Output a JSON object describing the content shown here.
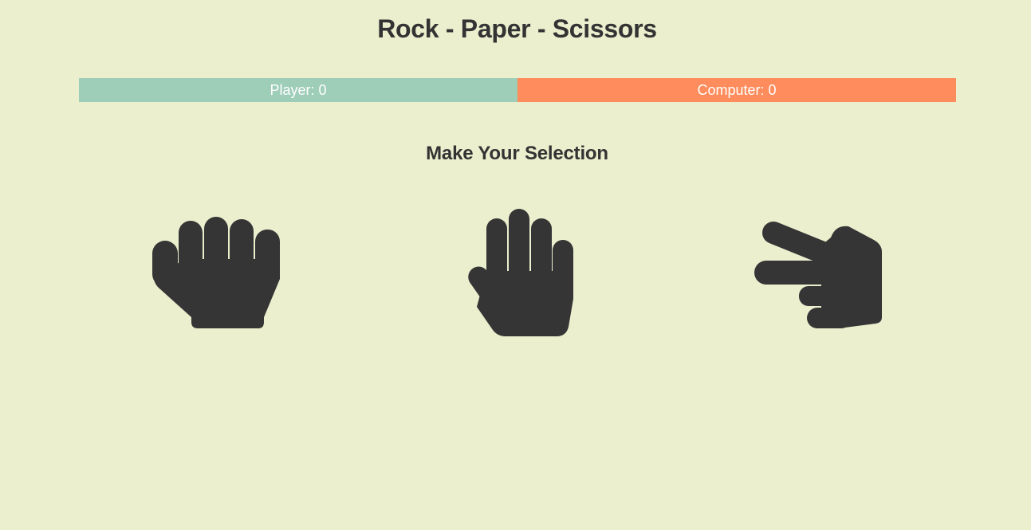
{
  "header": {
    "title": "Rock - Paper - Scissors"
  },
  "scoreboard": {
    "player_label": "Player: 0",
    "computer_label": "Computer: 0",
    "player_color": "#9ecdb8",
    "computer_color": "#ff8c5c"
  },
  "selection": {
    "heading": "Make Your Selection",
    "choices": [
      {
        "name": "rock",
        "icon": "hand-rock-icon"
      },
      {
        "name": "paper",
        "icon": "hand-paper-icon"
      },
      {
        "name": "scissors",
        "icon": "hand-scissors-icon"
      }
    ]
  },
  "colors": {
    "background": "#ebefce",
    "text": "#333333",
    "icon": "#353535"
  }
}
